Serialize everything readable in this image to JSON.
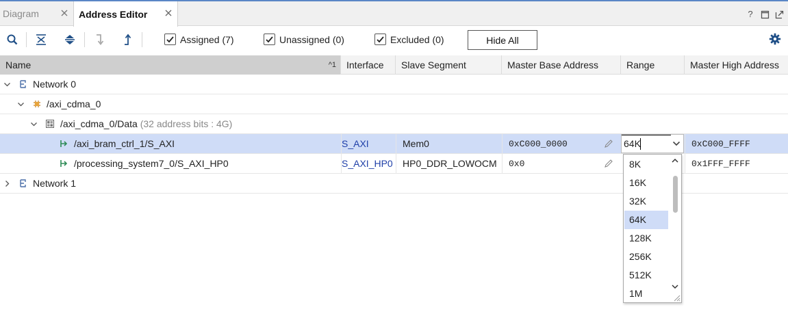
{
  "tabs": [
    {
      "label": "Diagram",
      "active": false
    },
    {
      "label": "Address Editor",
      "active": true
    }
  ],
  "window_controls": [
    "help-icon",
    "restore-icon",
    "float-icon"
  ],
  "toolbar": {
    "icons": [
      "search-icon",
      "collapse-all-icon",
      "expand-all-icon",
      "assign-icon",
      "unassign-icon"
    ],
    "checkboxes": [
      {
        "label": "Assigned (7)",
        "checked": true
      },
      {
        "label": "Unassigned (0)",
        "checked": true
      },
      {
        "label": "Excluded (0)",
        "checked": true
      }
    ],
    "hide_all_label": "Hide All",
    "settings_icon": "gear-icon"
  },
  "columns": {
    "name": "Name",
    "sort_indicator": "^1",
    "interface": "Interface",
    "slave_segment": "Slave Segment",
    "master_base_address": "Master Base Address",
    "range": "Range",
    "master_high_address": "Master High Address"
  },
  "rows": {
    "network0": {
      "label": "Network 0"
    },
    "cdma": {
      "label": "/axi_cdma_0"
    },
    "data": {
      "label": "/axi_cdma_0/Data",
      "detail": "(32 address bits : 4G)"
    },
    "bram": {
      "label": "/axi_bram_ctrl_1/S_AXI",
      "interface": "S_AXI",
      "slave_segment": "Mem0",
      "base": "0xC000_0000",
      "range": "64K",
      "high": "0xC000_FFFF"
    },
    "ps7": {
      "label": "/processing_system7_0/S_AXI_HP0",
      "interface": "S_AXI_HP0",
      "slave_segment": "HP0_DDR_LOWOCM",
      "base": "0x0",
      "high": "0x1FFF_FFFF"
    },
    "network1": {
      "label": "Network 1"
    }
  },
  "range_options": [
    "8K",
    "16K",
    "32K",
    "64K",
    "128K",
    "256K",
    "512K",
    "1M"
  ],
  "range_selected": "64K",
  "colors": {
    "accent": "#5a86c6",
    "selection": "#cfdcf7",
    "link": "#1f3fa8"
  }
}
